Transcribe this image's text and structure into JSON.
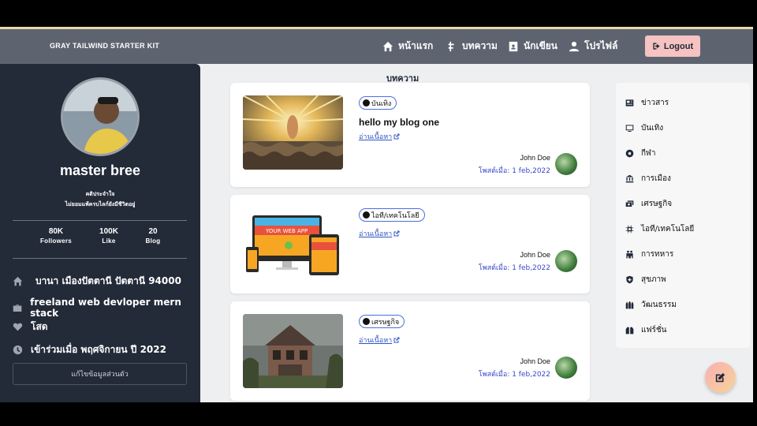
{
  "navbar": {
    "brand": "GRAY TAILWIND STARTER KIT",
    "items": [
      {
        "label": "หน้าแรก",
        "icon": "home-icon"
      },
      {
        "label": "บทความ",
        "icon": "article-icon"
      },
      {
        "label": "นักเขียน",
        "icon": "writer-icon"
      },
      {
        "label": "โปรไฟล์",
        "icon": "user-icon"
      }
    ],
    "logout": "Logout"
  },
  "profile": {
    "name": "master bree",
    "tagline1": "คติประจำใจ",
    "tagline2": "ไม่ยอมแพ้ครบไลก์ยังมีชีวิตอยู่",
    "stats": [
      {
        "value": "80K",
        "label": "Followers"
      },
      {
        "value": "100K",
        "label": "Like"
      },
      {
        "value": "20",
        "label": "Blog"
      }
    ],
    "info": [
      {
        "icon": "home-icon",
        "text": "บานา เมืองปัตตานี ปัตตานี 94000"
      },
      {
        "icon": "briefcase-icon",
        "text": "freeland web devloper mern stack"
      },
      {
        "icon": "heart-icon",
        "text": "โสด"
      },
      {
        "icon": "clock-icon",
        "text": "เข้าร่วมเมื่อ พฤศจิกายน ปี 2022"
      }
    ],
    "edit_button": "แก้ไขข้อมูลส่วนตัว"
  },
  "main": {
    "title": "บทความ",
    "posts": [
      {
        "category": "บันเทิง",
        "title": "hello my blog one",
        "read_more": "อ่านเนื้อหา",
        "author": "John Doe",
        "posted": "โพสต์เมื่อ: 1 feb,2022",
        "image": "crowd-painting"
      },
      {
        "category": "ไอที/เทคโนโลยี",
        "title": "",
        "read_more": "อ่านเนื้อหา",
        "author": "John Doe",
        "posted": "โพสต์เมื่อ: 1 feb,2022",
        "image": "web-app-devices",
        "image_text": "YOUR WEB APP"
      },
      {
        "category": "เศรษฐกิจ",
        "title": "",
        "read_more": "อ่านเนื้อหา",
        "author": "John Doe",
        "posted": "โพสต์เมื่อ: 1 feb,2022",
        "image": "abandoned-house"
      }
    ]
  },
  "categories": [
    {
      "label": "ข่าวสาร",
      "icon": "newspaper-icon"
    },
    {
      "label": "บันเทิง",
      "icon": "tv-icon"
    },
    {
      "label": "กีฬา",
      "icon": "ball-icon"
    },
    {
      "label": "การเมือง",
      "icon": "landmark-icon"
    },
    {
      "label": "เศรษฐกิจ",
      "icon": "money-icon"
    },
    {
      "label": "ไอที/เทคโนโลยี",
      "icon": "chip-icon"
    },
    {
      "label": "การทหาร",
      "icon": "soldiers-icon"
    },
    {
      "label": "สุขภาพ",
      "icon": "shield-icon"
    },
    {
      "label": "วัฒนธรรม",
      "icon": "culture-icon"
    },
    {
      "label": "แฟร์ชั่น",
      "icon": "fashion-icon"
    }
  ],
  "colors": {
    "navbar": "#5d6470",
    "sidebar": "#232a38",
    "accent_link": "#2f55c4",
    "logout_bg": "#f6c2c2"
  }
}
